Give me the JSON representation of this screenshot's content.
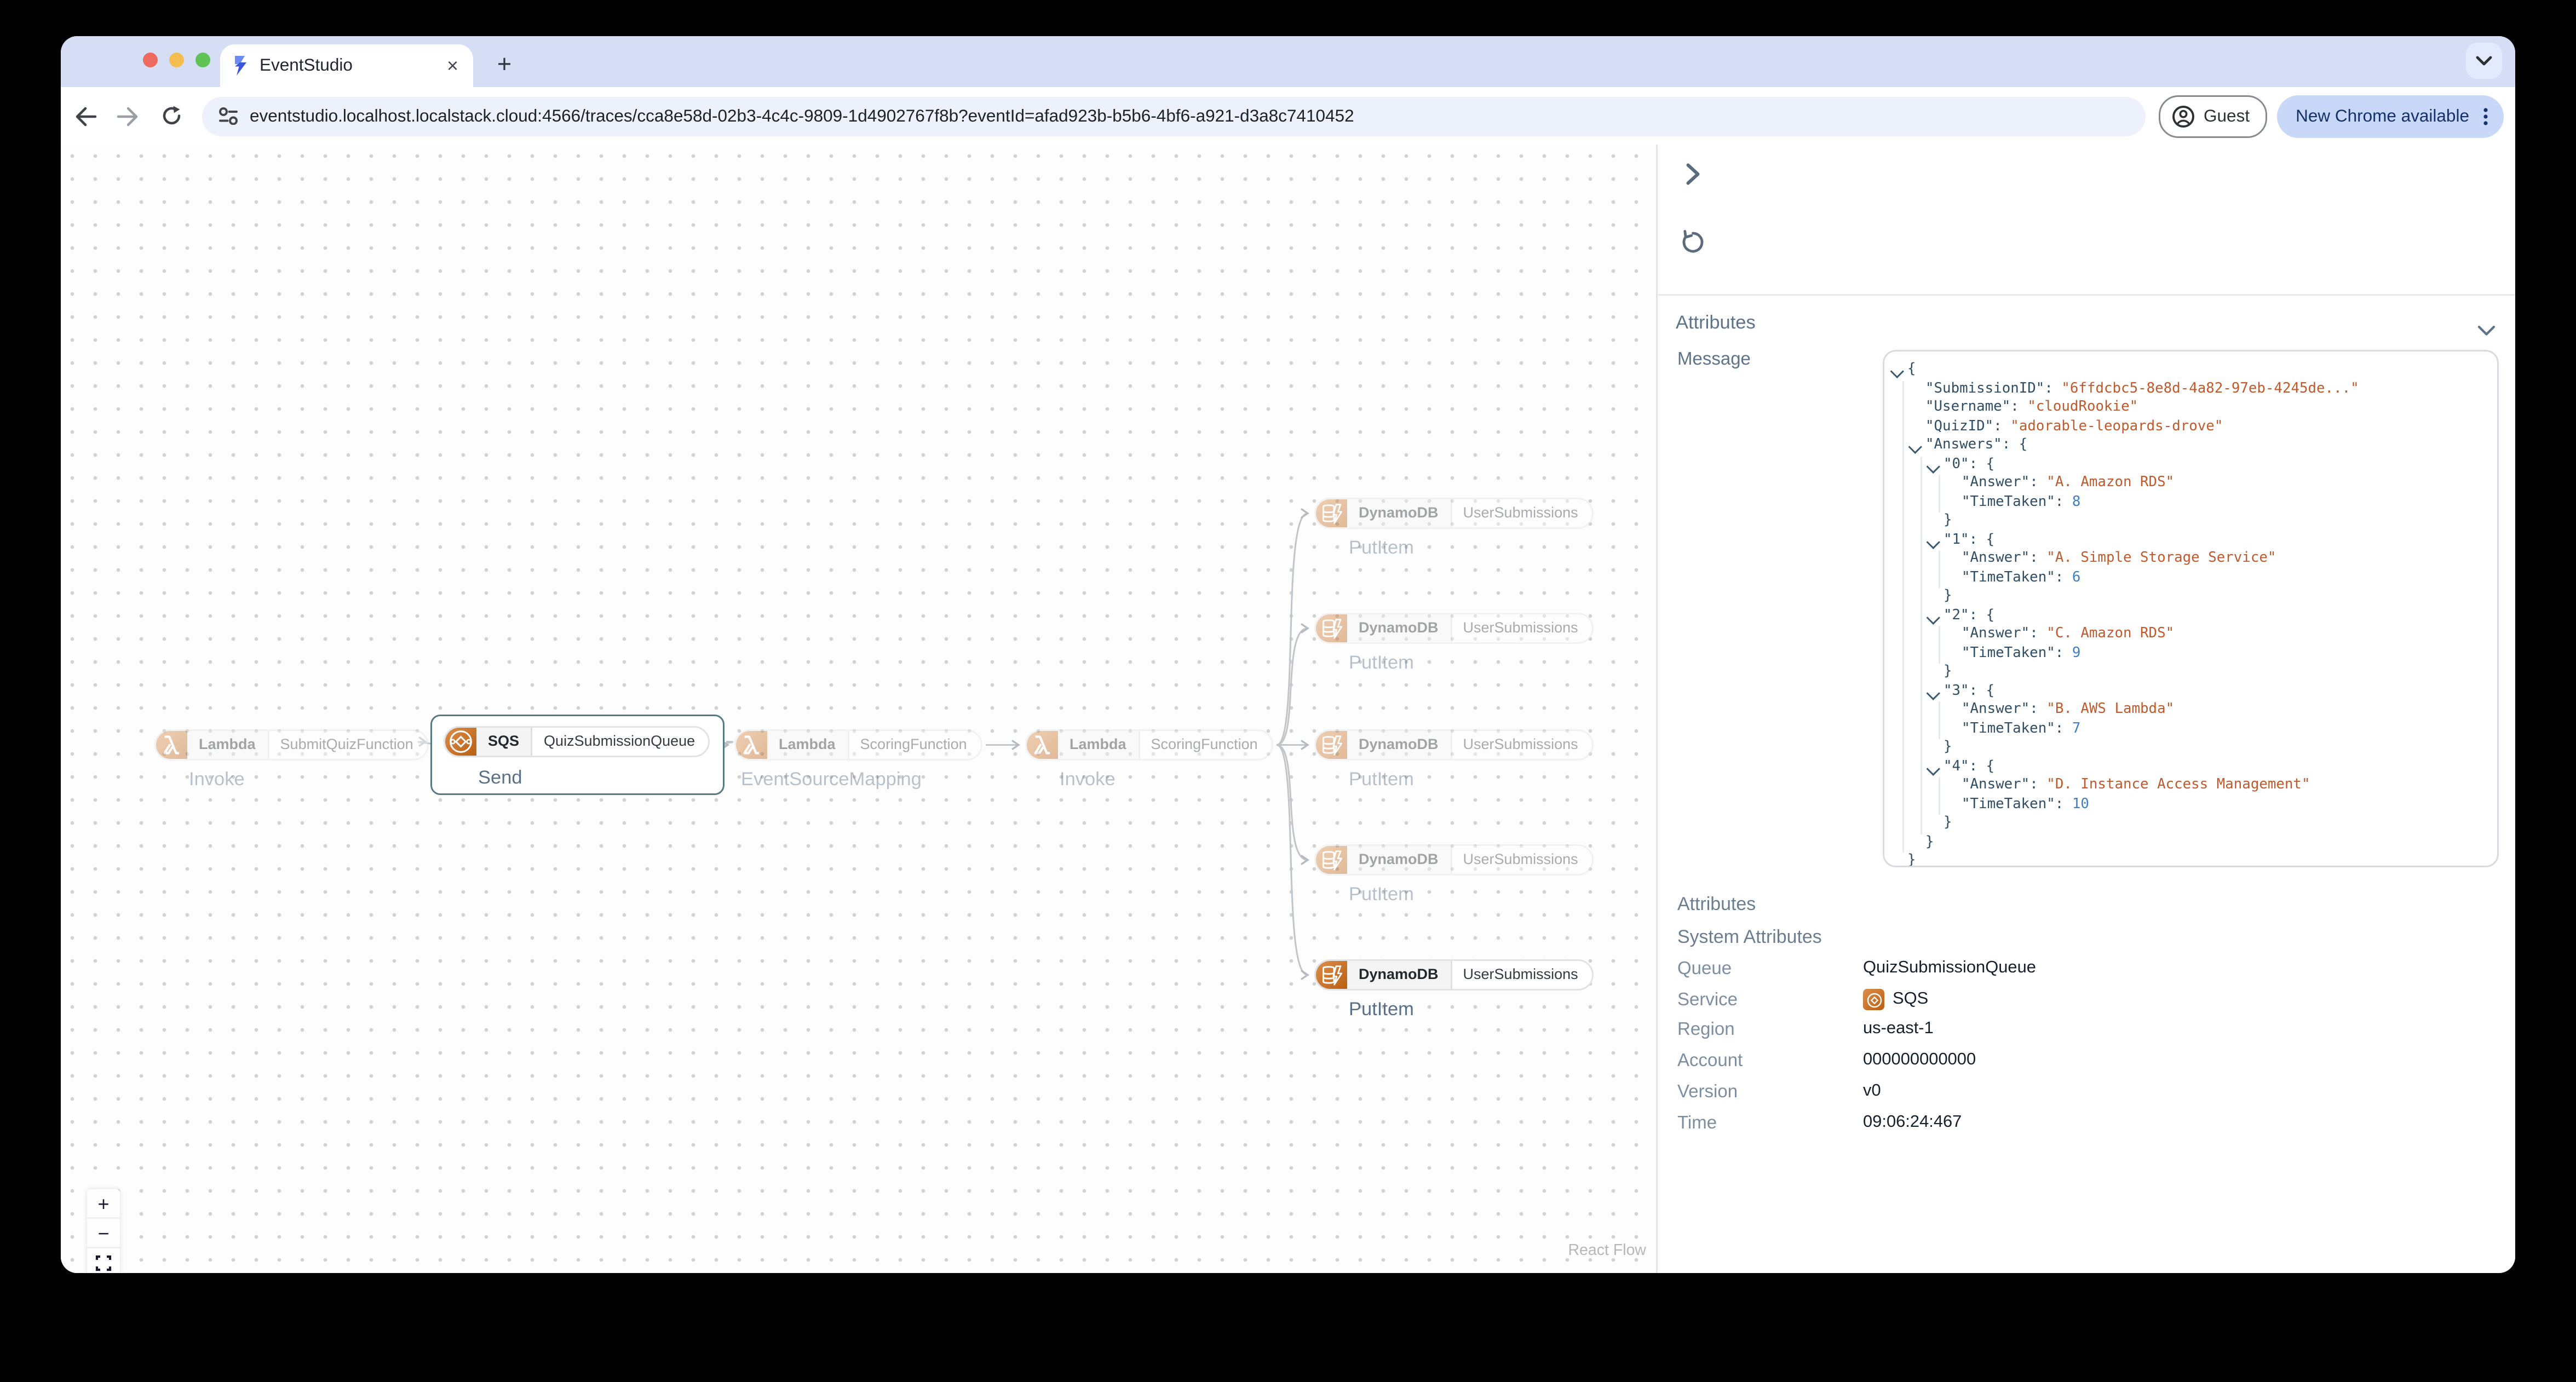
{
  "browser": {
    "tab_title": "EventStudio",
    "url": "eventstudio.localhost.localstack.cloud:4566/traces/cca8e58d-02b3-4c4c-9809-1d4902767f8b?eventId=afad923b-b5b6-4bf6-a921-d3a8c7410452",
    "guest_label": "Guest",
    "update_label": "New Chrome available",
    "close_tab_glyph": "×",
    "new_tab_glyph": "+"
  },
  "colors": {
    "accent_orange": "#c06418",
    "selection_border": "#567a84",
    "tabstrip": "#d6def6",
    "update_pill": "#c9d8f8",
    "json_key": "#2f4e66",
    "json_string": "#c05a2c",
    "json_number": "#3f7fc9"
  },
  "canvas": {
    "attribution": "React Flow",
    "controls": [
      {
        "name": "zoom-in",
        "glyph": "+"
      },
      {
        "name": "zoom-out",
        "glyph": "−"
      },
      {
        "name": "fit-view",
        "glyph": "fit"
      }
    ],
    "nodes": [
      {
        "service": "Lambda",
        "resource": "SubmitQuizFunction",
        "operation": "Invoke",
        "icon": "lambda-icon",
        "faded": true,
        "selected": false
      },
      {
        "service": "SQS",
        "resource": "QuizSubmissionQueue",
        "operation": "Send",
        "icon": "sqs-icon",
        "faded": false,
        "selected": true
      },
      {
        "service": "Lambda",
        "resource": "ScoringFunction",
        "operation": "EventSourceMapping",
        "icon": "lambda-icon",
        "faded": true,
        "selected": false
      },
      {
        "service": "Lambda",
        "resource": "ScoringFunction",
        "operation": "Invoke",
        "icon": "lambda-icon",
        "faded": true,
        "selected": false
      },
      {
        "service": "DynamoDB",
        "resource": "UserSubmissions",
        "operation": "PutItem",
        "icon": "dynamodb-icon",
        "faded": true,
        "selected": false
      },
      {
        "service": "DynamoDB",
        "resource": "UserSubmissions",
        "operation": "PutItem",
        "icon": "dynamodb-icon",
        "faded": true,
        "selected": false
      },
      {
        "service": "DynamoDB",
        "resource": "UserSubmissions",
        "operation": "PutItem",
        "icon": "dynamodb-icon",
        "faded": true,
        "selected": false
      },
      {
        "service": "DynamoDB",
        "resource": "UserSubmissions",
        "operation": "PutItem",
        "icon": "dynamodb-icon",
        "faded": true,
        "selected": false
      },
      {
        "service": "DynamoDB",
        "resource": "UserSubmissions",
        "operation": "PutItem",
        "icon": "dynamodb-icon",
        "faded": false,
        "selected": false
      }
    ]
  },
  "panel": {
    "attributes_header": "Attributes",
    "message_label": "Message",
    "message_json": {
      "SubmissionID": "6ffdcbc5-8e8d-4a82-97eb-4245de...",
      "Username": "cloudRookie",
      "QuizID": "adorable-leopards-drove",
      "Answers": {
        "0": {
          "Answer": "A. Amazon RDS",
          "TimeTaken": 8
        },
        "1": {
          "Answer": "A. Simple Storage Service",
          "TimeTaken": 6
        },
        "2": {
          "Answer": "C. Amazon RDS",
          "TimeTaken": 9
        },
        "3": {
          "Answer": "B. AWS Lambda",
          "TimeTaken": 7
        },
        "4": {
          "Answer": "D. Instance Access Management",
          "TimeTaken": 10
        }
      }
    },
    "json_lines": [
      {
        "i": 0,
        "c": true,
        "s": [
          [
            "p",
            "{"
          ]
        ]
      },
      {
        "i": 1,
        "c": false,
        "s": [
          [
            "k",
            "\"SubmissionID\""
          ],
          [
            "p",
            ": "
          ],
          [
            "s",
            "\"6ffdcbc5-8e8d-4a82-97eb-4245de...\""
          ]
        ]
      },
      {
        "i": 1,
        "c": false,
        "s": [
          [
            "k",
            "\"Username\""
          ],
          [
            "p",
            ": "
          ],
          [
            "s",
            "\"cloudRookie\""
          ]
        ]
      },
      {
        "i": 1,
        "c": false,
        "s": [
          [
            "k",
            "\"QuizID\""
          ],
          [
            "p",
            ": "
          ],
          [
            "s",
            "\"adorable-leopards-drove\""
          ]
        ]
      },
      {
        "i": 1,
        "c": true,
        "s": [
          [
            "k",
            "\"Answers\""
          ],
          [
            "p",
            ": {"
          ]
        ]
      },
      {
        "i": 2,
        "c": true,
        "s": [
          [
            "k",
            "\"0\""
          ],
          [
            "p",
            ": {"
          ]
        ]
      },
      {
        "i": 3,
        "c": false,
        "s": [
          [
            "k",
            "\"Answer\""
          ],
          [
            "p",
            ": "
          ],
          [
            "s",
            "\"A. Amazon RDS\""
          ]
        ]
      },
      {
        "i": 3,
        "c": false,
        "s": [
          [
            "k",
            "\"TimeTaken\""
          ],
          [
            "p",
            ": "
          ],
          [
            "n",
            "8"
          ]
        ]
      },
      {
        "i": 2,
        "c": false,
        "s": [
          [
            "p",
            "}"
          ]
        ]
      },
      {
        "i": 2,
        "c": true,
        "s": [
          [
            "k",
            "\"1\""
          ],
          [
            "p",
            ": {"
          ]
        ]
      },
      {
        "i": 3,
        "c": false,
        "s": [
          [
            "k",
            "\"Answer\""
          ],
          [
            "p",
            ": "
          ],
          [
            "s",
            "\"A. Simple Storage Service\""
          ]
        ]
      },
      {
        "i": 3,
        "c": false,
        "s": [
          [
            "k",
            "\"TimeTaken\""
          ],
          [
            "p",
            ": "
          ],
          [
            "n",
            "6"
          ]
        ]
      },
      {
        "i": 2,
        "c": false,
        "s": [
          [
            "p",
            "}"
          ]
        ]
      },
      {
        "i": 2,
        "c": true,
        "s": [
          [
            "k",
            "\"2\""
          ],
          [
            "p",
            ": {"
          ]
        ]
      },
      {
        "i": 3,
        "c": false,
        "s": [
          [
            "k",
            "\"Answer\""
          ],
          [
            "p",
            ": "
          ],
          [
            "s",
            "\"C. Amazon RDS\""
          ]
        ]
      },
      {
        "i": 3,
        "c": false,
        "s": [
          [
            "k",
            "\"TimeTaken\""
          ],
          [
            "p",
            ": "
          ],
          [
            "n",
            "9"
          ]
        ]
      },
      {
        "i": 2,
        "c": false,
        "s": [
          [
            "p",
            "}"
          ]
        ]
      },
      {
        "i": 2,
        "c": true,
        "s": [
          [
            "k",
            "\"3\""
          ],
          [
            "p",
            ": {"
          ]
        ]
      },
      {
        "i": 3,
        "c": false,
        "s": [
          [
            "k",
            "\"Answer\""
          ],
          [
            "p",
            ": "
          ],
          [
            "s",
            "\"B. AWS Lambda\""
          ]
        ]
      },
      {
        "i": 3,
        "c": false,
        "s": [
          [
            "k",
            "\"TimeTaken\""
          ],
          [
            "p",
            ": "
          ],
          [
            "n",
            "7"
          ]
        ]
      },
      {
        "i": 2,
        "c": false,
        "s": [
          [
            "p",
            "}"
          ]
        ]
      },
      {
        "i": 2,
        "c": true,
        "s": [
          [
            "k",
            "\"4\""
          ],
          [
            "p",
            ": {"
          ]
        ]
      },
      {
        "i": 3,
        "c": false,
        "s": [
          [
            "k",
            "\"Answer\""
          ],
          [
            "p",
            ": "
          ],
          [
            "s",
            "\"D. Instance Access Management\""
          ]
        ]
      },
      {
        "i": 3,
        "c": false,
        "s": [
          [
            "k",
            "\"TimeTaken\""
          ],
          [
            "p",
            ": "
          ],
          [
            "n",
            "10"
          ]
        ]
      },
      {
        "i": 2,
        "c": false,
        "s": [
          [
            "p",
            "}"
          ]
        ]
      },
      {
        "i": 1,
        "c": false,
        "s": [
          [
            "p",
            "}"
          ]
        ]
      },
      {
        "i": 0,
        "c": false,
        "s": [
          [
            "p",
            "}"
          ]
        ]
      }
    ],
    "details": [
      {
        "label": "Attributes",
        "value": null,
        "section": true
      },
      {
        "label": "System Attributes",
        "value": null,
        "section": true
      },
      {
        "label": "Queue",
        "value": "QuizSubmissionQueue"
      },
      {
        "label": "Service",
        "value": "SQS",
        "icon": "sqs-icon"
      },
      {
        "label": "Region",
        "value": "us-east-1"
      },
      {
        "label": "Account",
        "value": "000000000000"
      },
      {
        "label": "Version",
        "value": "v0"
      },
      {
        "label": "Time",
        "value": "09:06:24:467"
      }
    ]
  }
}
